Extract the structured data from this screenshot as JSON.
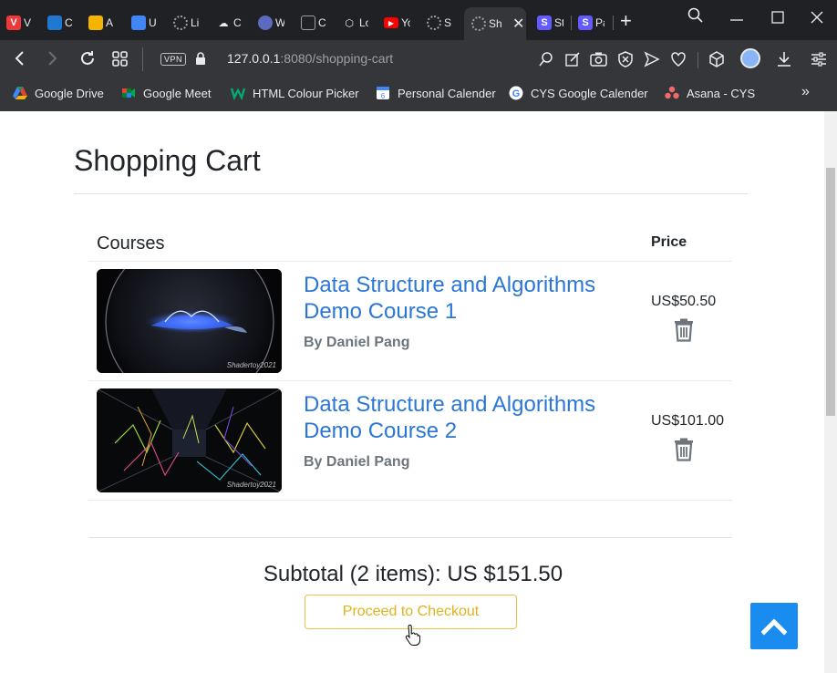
{
  "browser": {
    "tabs": [
      {
        "title": "V",
        "icon": "vivaldi-icon",
        "color": "#ef3939"
      },
      {
        "title": "C",
        "icon": "trello-icon",
        "color": "#1f78d1"
      },
      {
        "title": "A",
        "icon": "slides-icon",
        "color": "#f4b400"
      },
      {
        "title": "U",
        "icon": "docs-icon",
        "color": "#4285f4"
      },
      {
        "title": "Li",
        "icon": "loading-icon",
        "color": "#9aa0a6"
      },
      {
        "title": "C",
        "icon": "cloud-icon",
        "color": "#e8eaed"
      },
      {
        "title": "W",
        "icon": "web-icon",
        "color": "#5c6bc0"
      },
      {
        "title": "C",
        "icon": "network-icon",
        "color": "#9aa0a6"
      },
      {
        "title": "Lo",
        "icon": "hex-icon",
        "color": "#9aa0a6"
      },
      {
        "title": "Yo",
        "icon": "youtube-icon",
        "color": "#ff0000"
      },
      {
        "title": "S",
        "icon": "loading-icon",
        "color": "#9aa0a6"
      },
      {
        "title": "Sh",
        "icon": "loading-icon",
        "color": "#9aa0a6",
        "active": true
      },
      {
        "title": "St",
        "icon": "stripe-icon",
        "color": "#635bff"
      },
      {
        "title": "Pa",
        "icon": "stripe-icon",
        "color": "#635bff"
      }
    ],
    "url_host": "127.0.0.1",
    "url_rest": ":8080/shopping-cart",
    "vpn_label": "VPN",
    "bookmarks": [
      {
        "label": "Google Drive",
        "icon": "drive-icon"
      },
      {
        "label": "Google Meet",
        "icon": "meet-icon"
      },
      {
        "label": "HTML Colour Picker",
        "icon": "w-icon"
      },
      {
        "label": "Personal Calender",
        "icon": "calendar-icon"
      },
      {
        "label": "CYS Google Calender",
        "icon": "google-icon"
      },
      {
        "label": "Asana - CYS",
        "icon": "asana-icon"
      }
    ]
  },
  "cart": {
    "title": "Shopping Cart",
    "col_courses": "Courses",
    "col_price": "Price",
    "items": [
      {
        "title_line1": "Data Structure and Algorithms",
        "title_line2": "Demo Course 1",
        "author": "By Daniel Pang",
        "price": "US$50.50",
        "watermark": "Shadertoy2021"
      },
      {
        "title_line1": "Data Structure and Algorithms",
        "title_line2": "Demo Course 2",
        "author": "By Daniel Pang",
        "price": "US$101.00",
        "watermark": "Shadertoy2021"
      }
    ],
    "subtotal": "Subtotal (2 items): US $151.50",
    "checkout_label": "Proceed to Checkout"
  }
}
